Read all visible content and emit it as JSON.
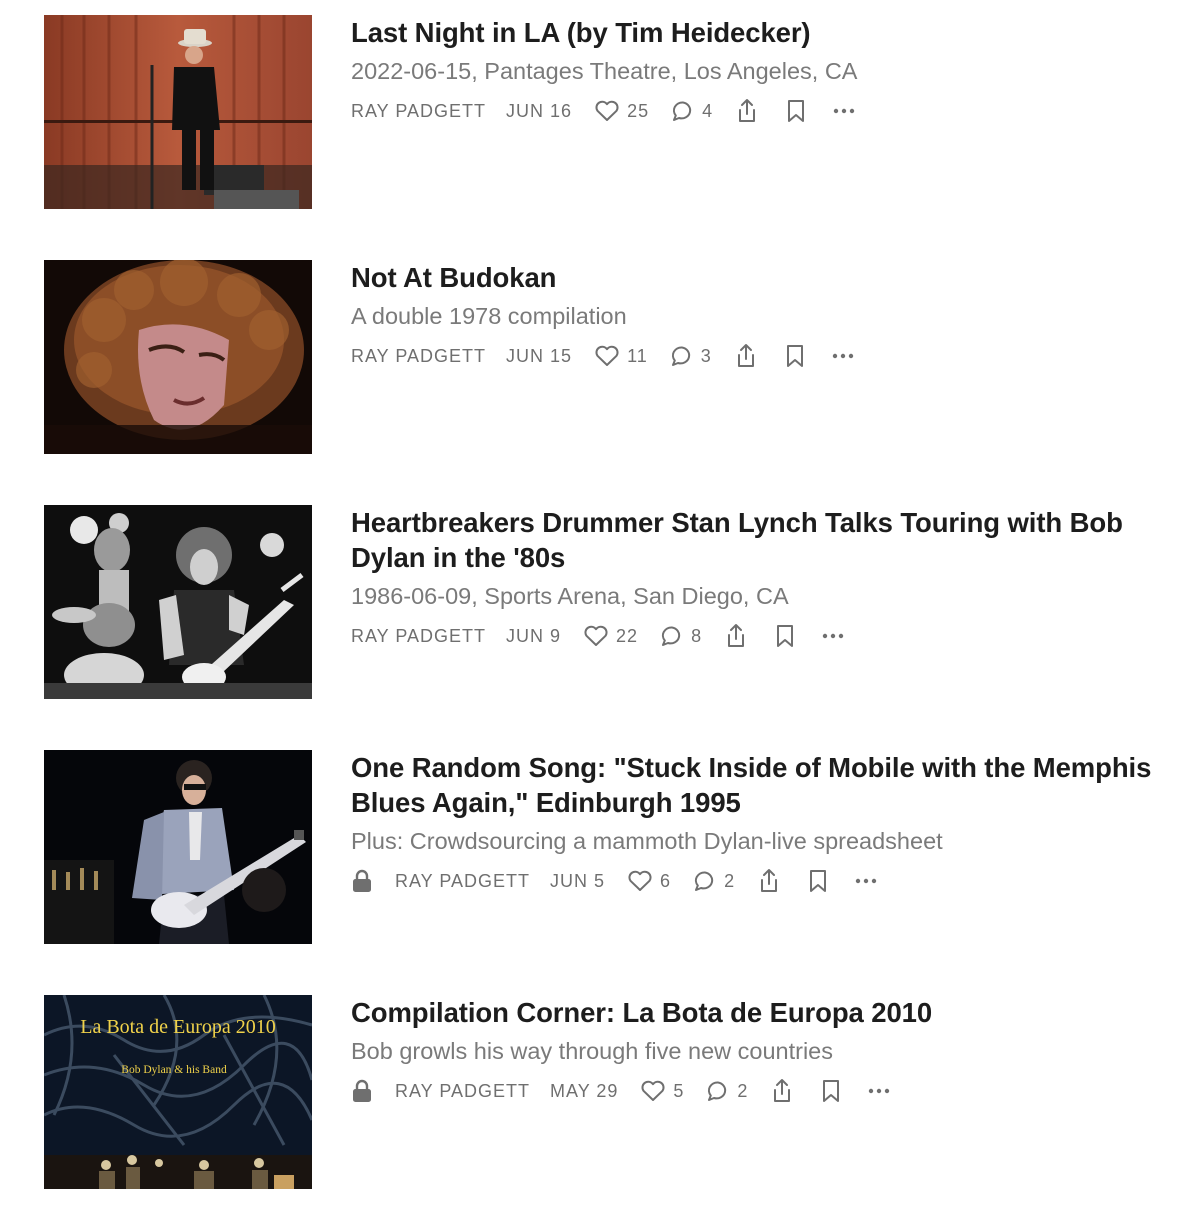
{
  "posts": [
    {
      "title": "Last Night in LA (by Tim Heidecker)",
      "subtitle": "2022-06-15, Pantages Theatre, Los Angeles, CA",
      "author": "RAY PADGETT",
      "date": "JUN 16",
      "likes": "25",
      "comments": "4",
      "locked": false,
      "image": "singer in hat on stage with red curtain"
    },
    {
      "title": "Not At Budokan",
      "subtitle": "A double 1978 compilation",
      "author": "RAY PADGETT",
      "date": "JUN 15",
      "likes": "11",
      "comments": "3",
      "locked": false,
      "image": "close-up of curly-haired singer"
    },
    {
      "title_line1": "Heartbreakers Drummer Stan Lynch Talks Touring with Bob",
      "title_line2": "Dylan in the '80s",
      "subtitle": "1986-06-09, Sports Arena, San Diego, CA",
      "author": "RAY PADGETT",
      "date": "JUN 9",
      "likes": "22",
      "comments": "8",
      "locked": false,
      "image": "black and white photo of drummer and guitarist"
    },
    {
      "title_line1": "One Random Song: \"Stuck Inside of Mobile with the Memphis",
      "title_line2": "Blues Again,\" Edinburgh 1995",
      "subtitle": "Plus: Crowdsourcing a mammoth Dylan-live spreadsheet",
      "author": "RAY PADGETT",
      "date": "JUN 5",
      "likes": "6",
      "comments": "2",
      "locked": true,
      "image": "guitarist in light jacket playing electric guitar"
    },
    {
      "title": "Compilation Corner: La Bota de Europa 2010",
      "subtitle": "Bob growls his way through five new countries",
      "author": "RAY PADGETT",
      "date": "MAY 29",
      "likes": "5",
      "comments": "2",
      "locked": true,
      "image": "album cover",
      "cover_title": "La Bota de Europa 2010",
      "cover_subtitle": "Bob Dylan & his Band"
    }
  ],
  "icons": {
    "like": "heart-icon",
    "comment": "comment-icon",
    "share": "share-icon",
    "bookmark": "bookmark-icon",
    "more": "more-icon",
    "lock": "lock-icon"
  },
  "colors": {
    "title": "#1d1d1d",
    "subtitle": "#7a7a7a",
    "meta": "#6f6f6f"
  }
}
